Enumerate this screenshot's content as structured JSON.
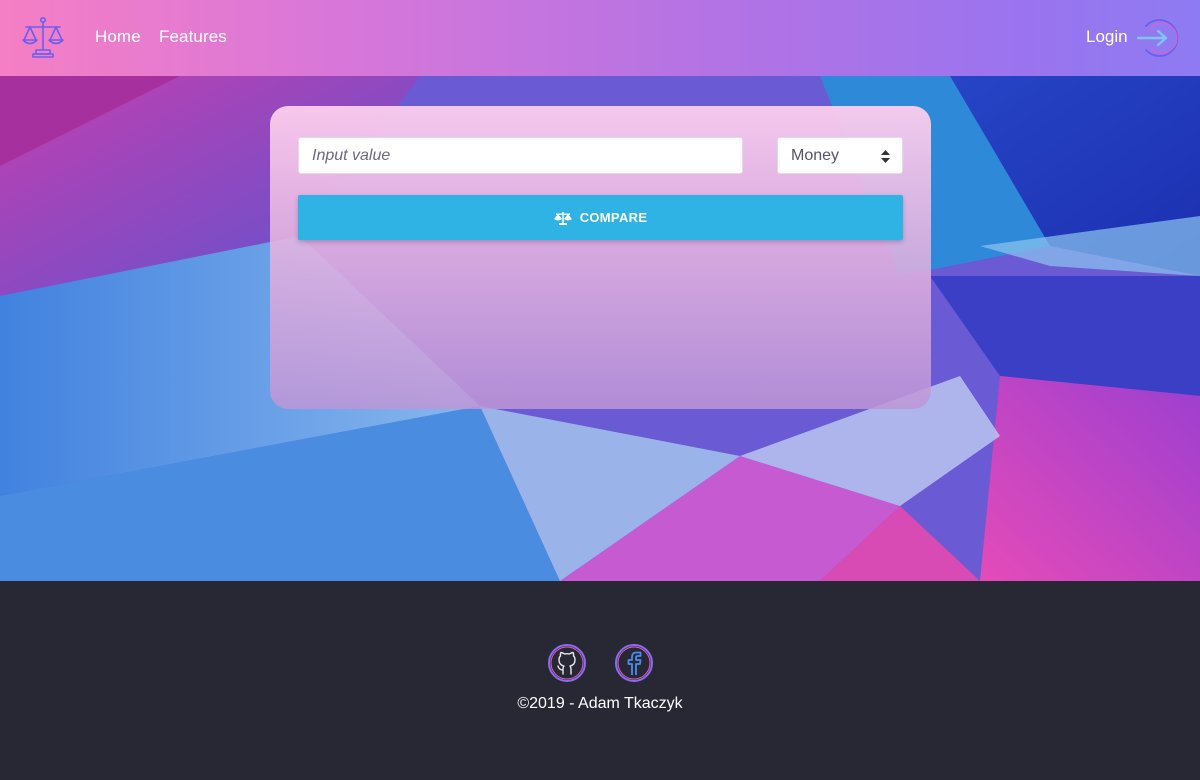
{
  "nav": {
    "logo_icon": "scales-icon",
    "links": [
      "Home",
      "Features"
    ],
    "login_label": "Login",
    "login_icon": "arrow-right-circle-icon"
  },
  "form": {
    "input_placeholder": "Input value",
    "unit_select": {
      "selected": "Money"
    },
    "compare_button": {
      "label": "COMPARE",
      "icon": "scales-icon"
    }
  },
  "footer": {
    "social": [
      {
        "name": "github",
        "icon": "github-icon"
      },
      {
        "name": "facebook",
        "icon": "facebook-icon"
      }
    ],
    "copyright": "©2019 - Adam Tkaczyk"
  },
  "colors": {
    "header_gradient": [
      "#f57fc4",
      "#b573e3",
      "#8e7bf3"
    ],
    "button": "#2fb3e5",
    "footer": "#282834"
  }
}
